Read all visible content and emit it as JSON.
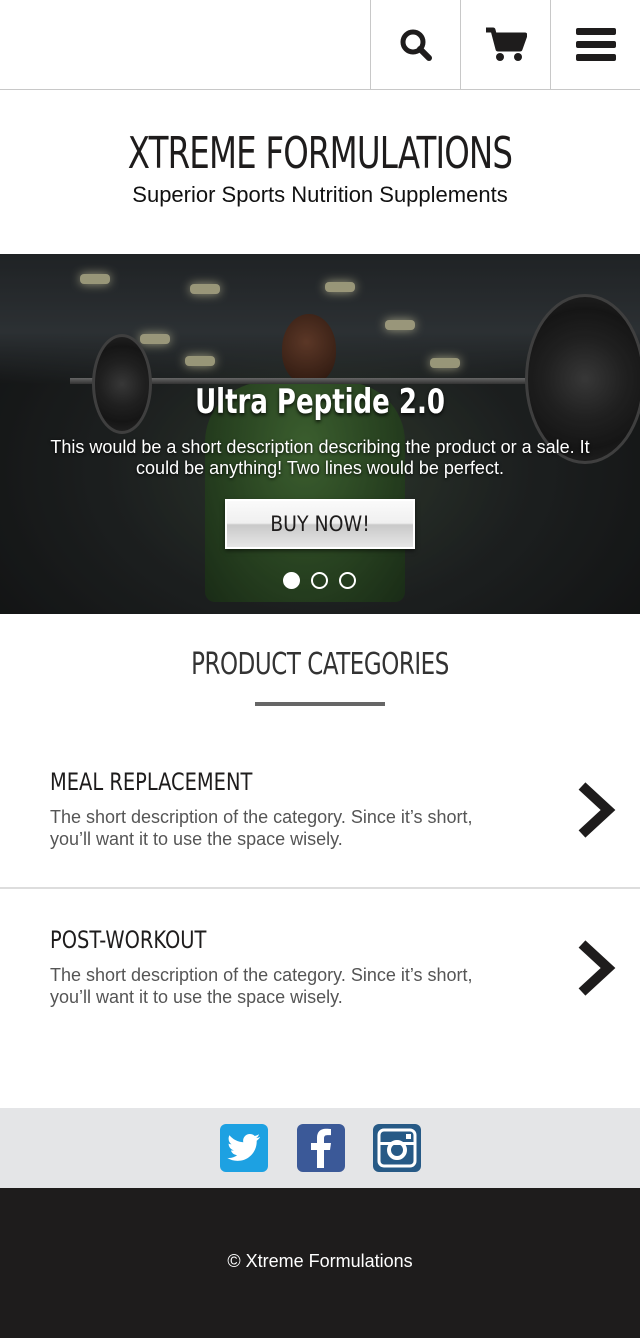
{
  "header": {
    "search_icon": "search-icon",
    "cart_icon": "cart-icon",
    "menu_icon": "hamburger-menu-icon"
  },
  "brand": {
    "title": "XTREME FORMULATIONS",
    "subtitle": "Superior Sports Nutrition Supplements"
  },
  "hero": {
    "title": "Ultra Peptide 2.0",
    "description": "This would be a short description describing the product or a sale. It could be anything! Two lines would be perfect.",
    "button_label": "BUY NOW!",
    "slides": 3,
    "active_slide": 1
  },
  "categories": {
    "heading": "PRODUCT CATEGORIES",
    "items": [
      {
        "name": "MEAL REPLACEMENT",
        "description": "The short description of the category. Since it’s short, you’ll want it to use the space wisely."
      },
      {
        "name": "POST-WORKOUT",
        "description": "The short description of the category. Since it’s short, you’ll want it to use the space wisely."
      }
    ]
  },
  "social": {
    "icons": [
      "twitter-icon",
      "facebook-icon",
      "instagram-icon"
    ],
    "colors": {
      "twitter": "#1da1e2",
      "facebook": "#3b5998",
      "instagram": "#275a86"
    }
  },
  "footer": {
    "copyright": "© Xtreme Formulations"
  },
  "colors": {
    "dark": "#1e1c1c",
    "social_bar": "#e4e5e7",
    "divider": "#c8c8c8"
  }
}
